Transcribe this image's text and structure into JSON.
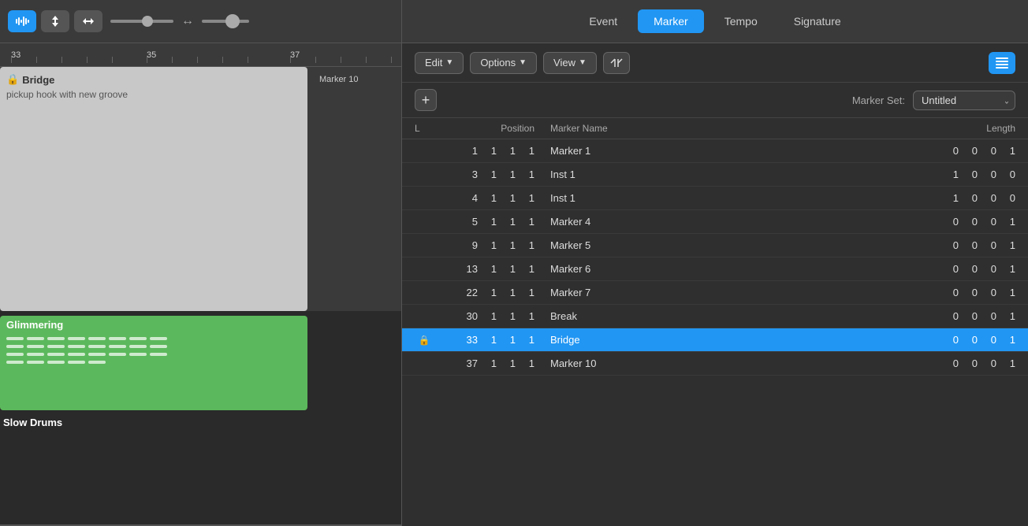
{
  "left": {
    "toolbar": {
      "tools": [
        "waveform",
        "up-down-arrow",
        "left-right-arrow",
        "circle-icon"
      ]
    },
    "ruler": {
      "marks": [
        "33",
        "35",
        "37"
      ]
    },
    "bridge": {
      "title": "Bridge",
      "subtitle": "pickup hook with new groove"
    },
    "marker10": "Marker 10",
    "glimmering": {
      "title": "Glimmering"
    },
    "slowDrums": "Slow Drums"
  },
  "right": {
    "tabs": [
      {
        "id": "event",
        "label": "Event",
        "active": false
      },
      {
        "id": "marker",
        "label": "Marker",
        "active": true
      },
      {
        "id": "tempo",
        "label": "Tempo",
        "active": false
      },
      {
        "id": "signature",
        "label": "Signature",
        "active": false
      }
    ],
    "actions": {
      "edit": "Edit",
      "options": "Options",
      "view": "View",
      "snap": "⌥|⌥",
      "list": "≡"
    },
    "markerSet": {
      "label": "Marker Set:",
      "value": "Untitled"
    },
    "addBtn": "+",
    "table": {
      "headers": [
        "L",
        "Position",
        "Marker Name",
        "Length"
      ],
      "rows": [
        {
          "lock": "",
          "pos": [
            "1",
            "1",
            "1",
            "1"
          ],
          "name": "Marker 1",
          "len": [
            "0",
            "0",
            "0",
            "1"
          ],
          "selected": false
        },
        {
          "lock": "",
          "pos": [
            "3",
            "1",
            "1",
            "1"
          ],
          "name": "Inst 1",
          "len": [
            "1",
            "0",
            "0",
            "0"
          ],
          "selected": false
        },
        {
          "lock": "",
          "pos": [
            "4",
            "1",
            "1",
            "1"
          ],
          "name": "Inst 1",
          "len": [
            "1",
            "0",
            "0",
            "0"
          ],
          "selected": false
        },
        {
          "lock": "",
          "pos": [
            "5",
            "1",
            "1",
            "1"
          ],
          "name": "Marker 4",
          "len": [
            "0",
            "0",
            "0",
            "1"
          ],
          "selected": false
        },
        {
          "lock": "",
          "pos": [
            "9",
            "1",
            "1",
            "1"
          ],
          "name": "Marker 5",
          "len": [
            "0",
            "0",
            "0",
            "1"
          ],
          "selected": false
        },
        {
          "lock": "",
          "pos": [
            "13",
            "1",
            "1",
            "1"
          ],
          "name": "Marker 6",
          "len": [
            "0",
            "0",
            "0",
            "1"
          ],
          "selected": false
        },
        {
          "lock": "",
          "pos": [
            "22",
            "1",
            "1",
            "1"
          ],
          "name": "Marker 7",
          "len": [
            "0",
            "0",
            "0",
            "1"
          ],
          "selected": false
        },
        {
          "lock": "",
          "pos": [
            "30",
            "1",
            "1",
            "1"
          ],
          "name": "Break",
          "len": [
            "0",
            "0",
            "0",
            "1"
          ],
          "selected": false
        },
        {
          "lock": "🔒",
          "pos": [
            "33",
            "1",
            "1",
            "1"
          ],
          "name": "Bridge",
          "len": [
            "0",
            "0",
            "0",
            "1"
          ],
          "selected": true
        },
        {
          "lock": "",
          "pos": [
            "37",
            "1",
            "1",
            "1"
          ],
          "name": "Marker 10",
          "len": [
            "0",
            "0",
            "0",
            "1"
          ],
          "selected": false
        }
      ]
    }
  }
}
